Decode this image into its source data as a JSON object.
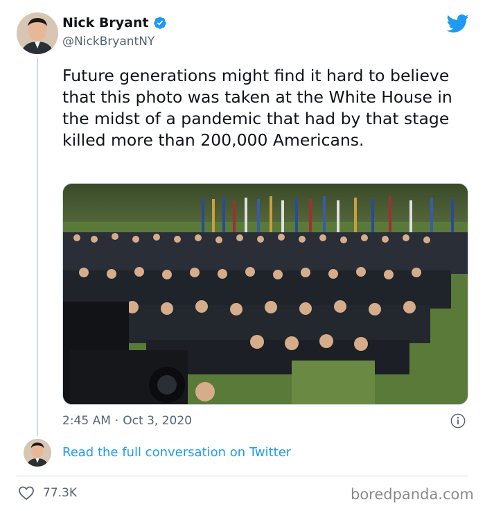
{
  "author": {
    "display_name": "Nick Bryant",
    "handle": "@NickBryantNY",
    "verified": true
  },
  "tweet": {
    "text": "Future generations might find it hard to believe that this photo was taken at the White House in the midst of a pandemic that had by that stage killed more than 200,000 Americans.",
    "time": "2:45 AM",
    "separator": "·",
    "date": "Oct 3, 2020"
  },
  "footer": {
    "conversation_link": "Read the full conversation on Twitter",
    "likes": "77.3K"
  },
  "watermark": "boredpanda.com",
  "icons": {
    "brand": "twitter-bird-icon",
    "verified": "verified-badge-icon",
    "info": "info-icon",
    "like": "heart-icon"
  },
  "colors": {
    "accent": "#1d9bf0",
    "text": "#0f1419",
    "muted": "#536471",
    "divider": "#cfd9de"
  }
}
